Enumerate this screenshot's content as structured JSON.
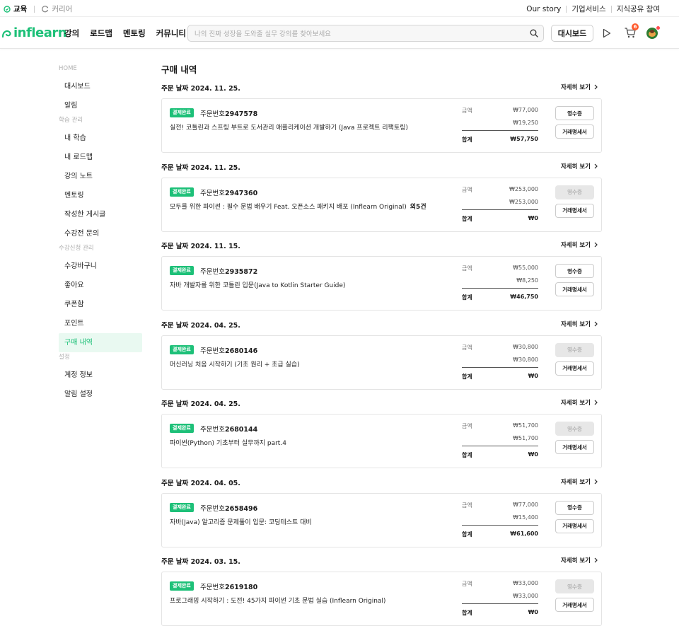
{
  "topbar": {
    "tabs": [
      {
        "label": "교육",
        "active": true,
        "icon": "edu-icon"
      },
      {
        "label": "커리어",
        "active": false,
        "icon": "career-icon"
      }
    ],
    "links": [
      "Our story",
      "기업서비스",
      "지식공유 참여"
    ]
  },
  "header": {
    "logo": "inflearn",
    "nav": [
      "강의",
      "로드맵",
      "멘토링",
      "커뮤니티"
    ],
    "search_placeholder": "나의 진짜 성장을 도와줄 실무 강의를 찾아보세요",
    "dashboard_label": "대시보드",
    "cart_count": "6",
    "brand_color": "#1dc078"
  },
  "sidebar": {
    "items": [
      {
        "label": "HOME",
        "type": "group"
      },
      {
        "label": "대시보드",
        "type": "item"
      },
      {
        "label": "알림",
        "type": "item"
      },
      {
        "label": "학습 관리",
        "type": "group"
      },
      {
        "label": "내 학습",
        "type": "item"
      },
      {
        "label": "내 로드맵",
        "type": "item"
      },
      {
        "label": "강의 노트",
        "type": "item"
      },
      {
        "label": "멘토링",
        "type": "item"
      },
      {
        "label": "작성한 게시글",
        "type": "item"
      },
      {
        "label": "수강전 문의",
        "type": "item"
      },
      {
        "label": "수강신청 관리",
        "type": "group"
      },
      {
        "label": "수강바구니",
        "type": "item"
      },
      {
        "label": "좋아요",
        "type": "item"
      },
      {
        "label": "쿠폰함",
        "type": "item"
      },
      {
        "label": "포인트",
        "type": "item"
      },
      {
        "label": "구매 내역",
        "type": "item",
        "active": true
      },
      {
        "label": "설정",
        "type": "group"
      },
      {
        "label": "계정 정보",
        "type": "item"
      },
      {
        "label": "알림 설정",
        "type": "item"
      }
    ]
  },
  "main": {
    "title": "구매 내역",
    "detail_label": "자세히 보기",
    "status_label": "결제완료",
    "order_no_prefix": "주문번호",
    "amount_label": "금액",
    "total_label": "합계",
    "receipt_label": "영수증",
    "invoice_label": "거래명세서",
    "orders": [
      {
        "date": "주문 날짜 2024. 11. 25.",
        "order_no": "2947578",
        "course": "실전! 코틀린과 스프링 부트로 도서관리 애플리케이션 개발하기 (Java 프로젝트 리팩토링)",
        "extra": "",
        "amount": "₩77,000",
        "discount": "₩19,250",
        "total": "₩57,750",
        "receipt_enabled": true
      },
      {
        "date": "주문 날짜 2024. 11. 25.",
        "order_no": "2947360",
        "course": "모두를 위한 파이썬 : 필수 문법 배우기 Feat. 오픈소스 패키지 배포 (Inflearn Original)",
        "extra": "외5건",
        "amount": "₩253,000",
        "discount": "₩253,000",
        "total": "₩0",
        "receipt_enabled": false
      },
      {
        "date": "주문 날짜 2024. 11. 15.",
        "order_no": "2935872",
        "course": "자바 개발자를 위한 코틀린 입문(Java to Kotlin Starter Guide)",
        "extra": "",
        "amount": "₩55,000",
        "discount": "₩8,250",
        "total": "₩46,750",
        "receipt_enabled": true
      },
      {
        "date": "주문 날짜 2024. 04. 25.",
        "order_no": "2680146",
        "course": "머신러닝 처음 시작하기 (기초 원리 + 초급 실습)",
        "extra": "",
        "amount": "₩30,800",
        "discount": "₩30,800",
        "total": "₩0",
        "receipt_enabled": false
      },
      {
        "date": "주문 날짜 2024. 04. 25.",
        "order_no": "2680144",
        "course": "파이썬(Python) 기초부터 실무까지 part.4",
        "extra": "",
        "amount": "₩51,700",
        "discount": "₩51,700",
        "total": "₩0",
        "receipt_enabled": false
      },
      {
        "date": "주문 날짜 2024. 04. 05.",
        "order_no": "2658496",
        "course": "자바(Java) 알고리즘 문제풀이 입문: 코딩테스트 대비",
        "extra": "",
        "amount": "₩77,000",
        "discount": "₩15,400",
        "total": "₩61,600",
        "receipt_enabled": true
      },
      {
        "date": "주문 날짜 2024. 03. 15.",
        "order_no": "2619180",
        "course": "프로그래밍 시작하기 : 도전! 45가지 파이썬 기초 문법 실습 (Inflearn Original)",
        "extra": "",
        "amount": "₩33,000",
        "discount": "₩33,000",
        "total": "₩0",
        "receipt_enabled": false
      }
    ]
  }
}
